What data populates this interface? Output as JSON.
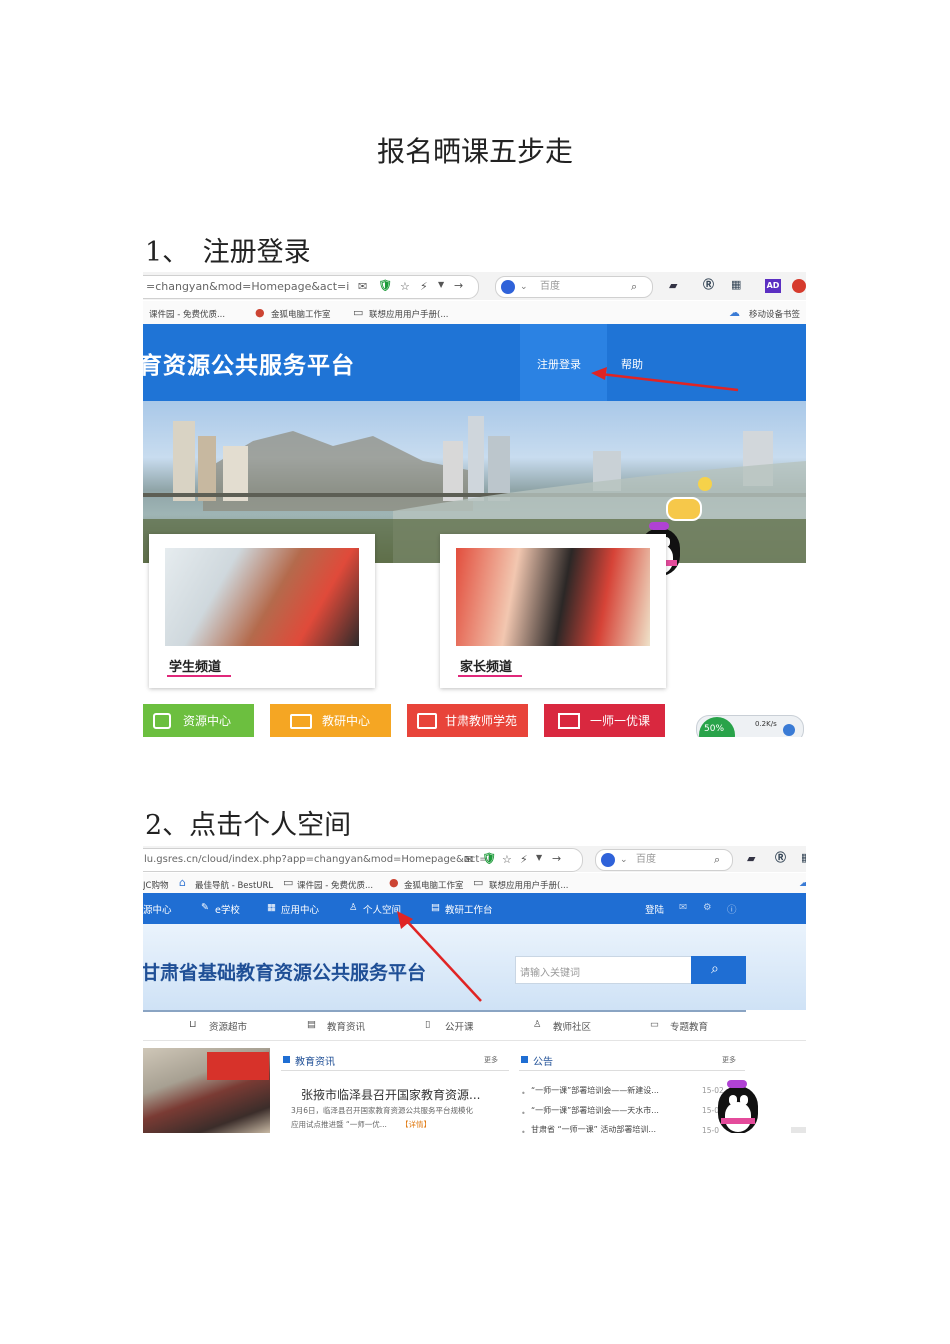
{
  "document": {
    "title": "报名晒课五步走",
    "step1": "1、　注册登录",
    "step2": "2、点击个人空间"
  },
  "shot1": {
    "url": "=changyan&mod=Homepage&act=i",
    "search_engine": "百度",
    "bookmarks": [
      "课件园 - 免费优质...",
      "金狐电脑工作室",
      "联想应用用户手册(...",
      "移动设备书签"
    ],
    "site_title": "育资源公共服务平台",
    "nav": {
      "register_login": "注册登录",
      "help": "帮助"
    },
    "cards": {
      "student": "学生频道",
      "parent": "家长频道"
    },
    "tiles": [
      "资源中心",
      "教研中心",
      "甘肃教师学苑",
      "一师一优课"
    ],
    "speed": {
      "percent": "50%",
      "rate": "0.2K/s"
    },
    "colors": {
      "banner": "#1f74d6",
      "tile_green": "#6cbf3f",
      "tile_orange": "#f5a623",
      "tile_red": "#e8443a",
      "tile_crimson": "#d9283f"
    }
  },
  "shot2": {
    "url": "lu.gsres.cn/cloud/index.php?app=changyan&mod=Homepage&act=i",
    "search_engine": "百度",
    "bookmarks": [
      "JC购物",
      "最佳导航 - BestURL",
      "课件园 - 免费优质...",
      "金狐电脑工作室",
      "联想应用用户手册(..."
    ],
    "nav": [
      "源中心",
      "e学校",
      "应用中心",
      "个人空间",
      "教研工作台"
    ],
    "login": "登陆",
    "site_title": "甘肃省基础教育资源公共服务平台",
    "search_placeholder": "请输入关键词",
    "subnav": [
      "资源超市",
      "教育资讯",
      "公开课",
      "教师社区",
      "专题教育"
    ],
    "news": {
      "heading": "教育资讯",
      "more": "更多",
      "headline": "张掖市临泽县召开国家教育资源...",
      "summary_line1": "3月6日，临泽县召开国家教育资源公共服务平台规模化",
      "summary_line2": "应用试点推进暨 “一师一优...",
      "detail": "【详情】"
    },
    "notice": {
      "heading": "公告",
      "more": "更多",
      "items": [
        {
          "text": "“一师一课”部署培训会——新建设...",
          "date": "15-02"
        },
        {
          "text": "“一师一课”部署培训会——天水市...",
          "date": "15-0"
        },
        {
          "text": "甘肃省 “一师一课” 活动部署培训...",
          "date": "15-0"
        }
      ]
    },
    "colors": {
      "navbar": "#1f6ed3",
      "search_button": "#1f6ed3"
    }
  }
}
